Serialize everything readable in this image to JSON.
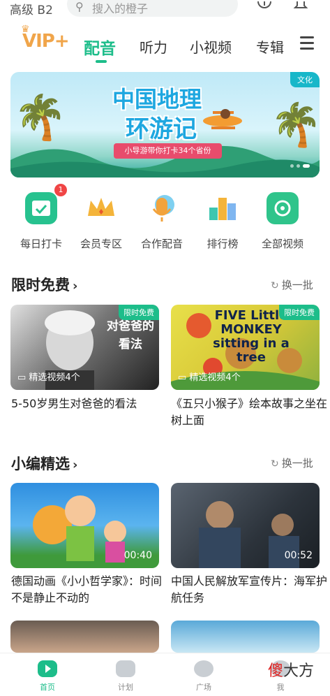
{
  "topbar": {
    "level": "高级 B2",
    "search_placeholder": "搜入的橙子"
  },
  "nav": {
    "vip": "VIP+",
    "tabs": [
      "配音",
      "听力",
      "小视频",
      "专辑"
    ],
    "active_tab": "配音"
  },
  "banner": {
    "tag": "文化",
    "title_line1": "中国地理",
    "title_line2": "环游记",
    "ribbon": "小导游带你打卡34个省份"
  },
  "quick": [
    {
      "label": "每日打卡",
      "badge": "1",
      "icon": "calendar-check-icon",
      "color": "#27c28f"
    },
    {
      "label": "会员专区",
      "icon": "crown-icon",
      "color": "#f4b43a"
    },
    {
      "label": "合作配音",
      "icon": "microphone-icon",
      "color": "#f2a33c"
    },
    {
      "label": "排行榜",
      "icon": "podium-icon",
      "color": "#3ec6b0"
    },
    {
      "label": "全部视频",
      "icon": "all-videos-icon",
      "color": "#2fc48b"
    }
  ],
  "sections": {
    "free": {
      "title": "限时免费",
      "refresh": "换一批",
      "cards": [
        {
          "tag": "限时免费",
          "overlay": "对爸爸的看法",
          "meta": "精选视频4个",
          "caption": "5-50岁男生对爸爸的看法"
        },
        {
          "tag": "限时免费",
          "overlay": "FIVE Little MONKEY sitting in a tree",
          "meta": "精选视频4个",
          "caption": "《五只小猴子》绘本故事之坐在树上面"
        }
      ]
    },
    "editor": {
      "title": "小编精选",
      "refresh": "换一批",
      "cards": [
        {
          "duration": "00:40",
          "caption": "德国动画《小小哲学家》：时间不是静止不动的"
        },
        {
          "duration": "00:52",
          "caption": "中国人民解放军宣传片：海军护航任务"
        }
      ]
    }
  },
  "bottom": {
    "items": [
      "首页",
      "计划",
      "广场",
      "我"
    ],
    "active": "首页"
  },
  "watermark": {
    "a": "傻",
    "b": "大方"
  },
  "colors": {
    "accent": "#1dbd8a",
    "badge": "#f04545",
    "vip": "#f0a54a"
  }
}
